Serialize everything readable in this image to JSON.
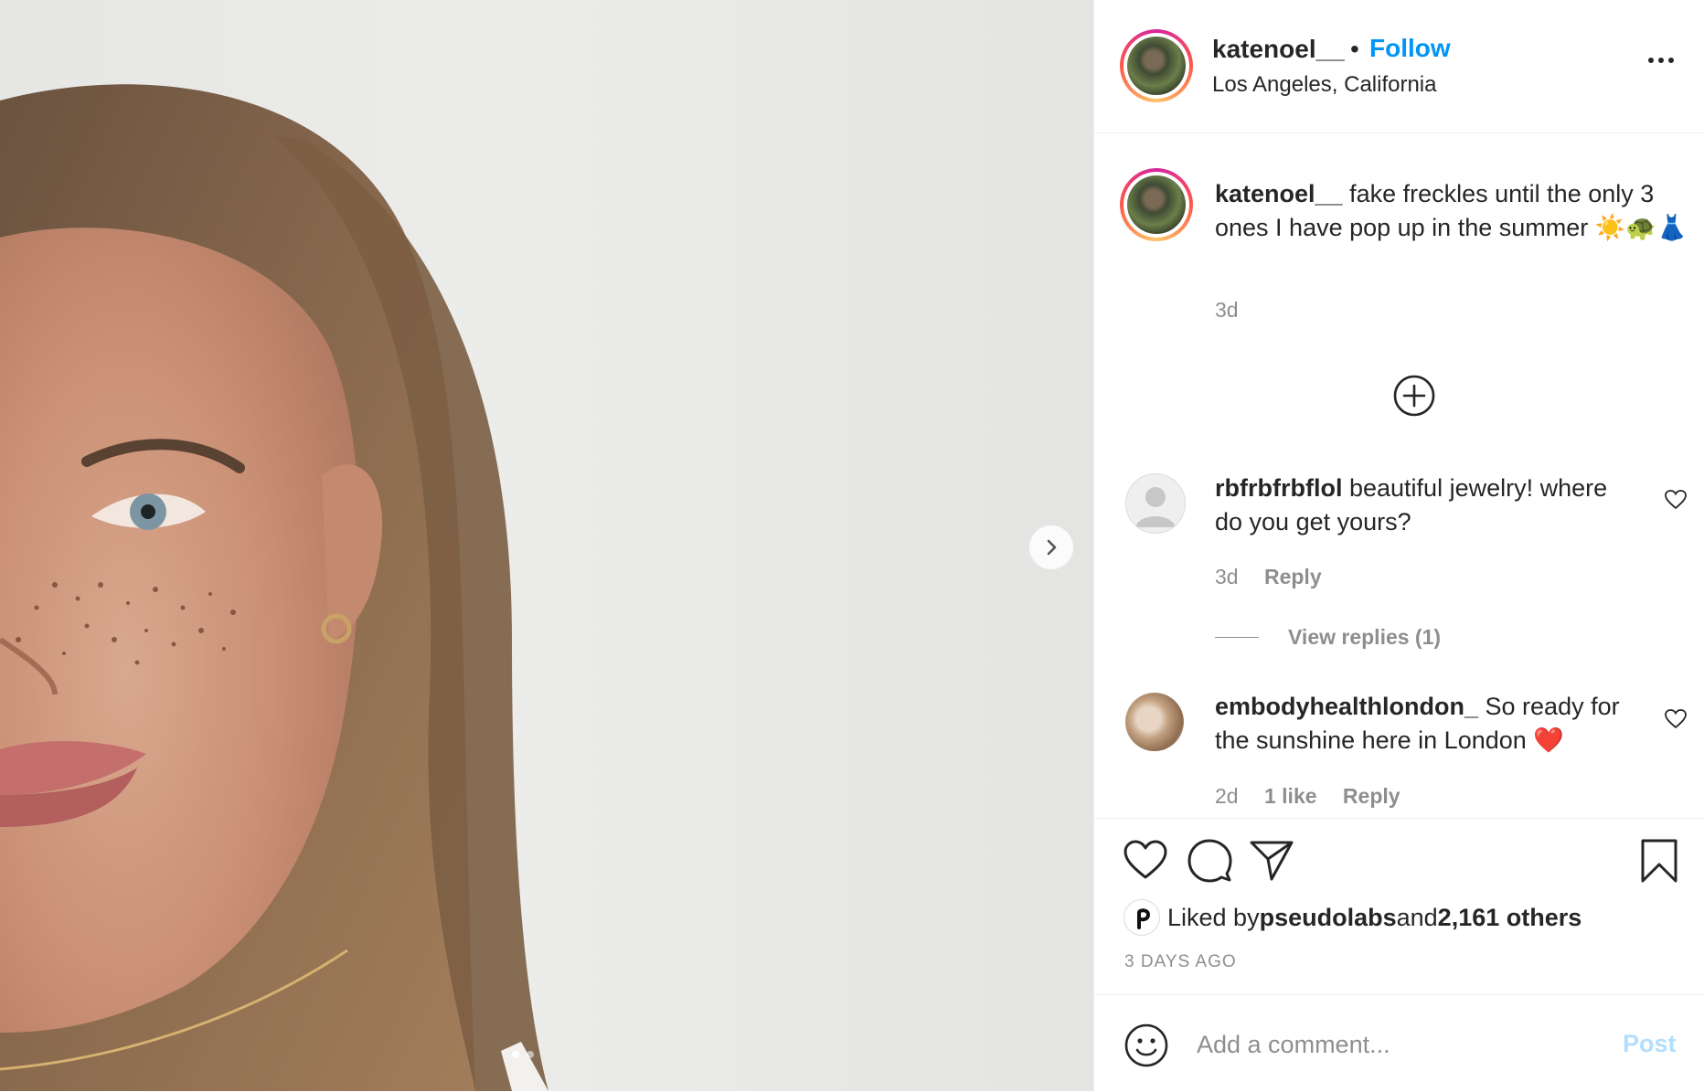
{
  "post": {
    "username": "katenoel__",
    "follow_label": "Follow",
    "separator": "•",
    "location": "Los Angeles, California"
  },
  "caption": {
    "username": "katenoel__",
    "text": " fake freckles until the only 3 ones I have pop up in the summer ☀️🐢👗",
    "time": "3d"
  },
  "comments": [
    {
      "username": "rbfrbfrbflol",
      "text": " beautiful jewelry! where do you get yours?",
      "time": "3d",
      "reply_label": "Reply",
      "view_replies": "View replies (1)"
    },
    {
      "username": "embodyhealthlondon_",
      "text": " So ready for the sunshine here in London ❤️",
      "time": "2d",
      "likes": "1 like",
      "reply_label": "Reply"
    }
  ],
  "likes": {
    "prefix": "Liked by ",
    "user": "pseudolabs",
    "middle": " and ",
    "others": "2,161 others"
  },
  "timestamp": "3 DAYS AGO",
  "add_comment": {
    "placeholder": "Add a comment...",
    "post_label": "Post"
  },
  "colors": {
    "follow_blue": "#0095f6",
    "post_disabled": "#b2dffc",
    "text": "#262626",
    "secondary": "#8e8e8e"
  },
  "icons": [
    "more-icon",
    "add-circle-icon",
    "heart-icon",
    "comment-icon",
    "share-icon",
    "bookmark-icon",
    "emoji-icon",
    "chevron-right-icon"
  ]
}
